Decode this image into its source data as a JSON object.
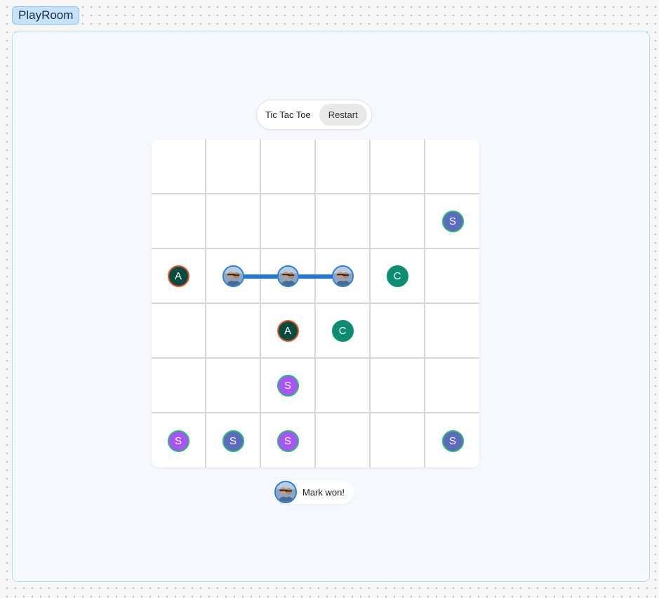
{
  "app": {
    "title": "PlayRoom"
  },
  "game": {
    "title": "Tic Tac Toe",
    "restart_label": "Restart"
  },
  "board": {
    "rows": 6,
    "cols": 6,
    "cells": [
      [
        null,
        null,
        null,
        null,
        null,
        null
      ],
      [
        null,
        null,
        null,
        null,
        null,
        {
          "type": "letter",
          "letter": "S",
          "bg": "#5c6bc0",
          "ring": "#2bb673"
        }
      ],
      [
        {
          "type": "letter",
          "letter": "A",
          "bg": "#0b4a3f",
          "ring": "#e0552a"
        },
        {
          "type": "photo"
        },
        {
          "type": "photo"
        },
        {
          "type": "photo"
        },
        {
          "type": "letter",
          "letter": "C",
          "bg": "#0e8c72",
          "ring": "#0e8c72"
        },
        null
      ],
      [
        null,
        null,
        {
          "type": "letter",
          "letter": "A",
          "bg": "#0b4a3f",
          "ring": "#e0552a"
        },
        {
          "type": "letter",
          "letter": "C",
          "bg": "#0e8c72",
          "ring": "#0e8c72"
        },
        null,
        null
      ],
      [
        null,
        null,
        {
          "type": "letter",
          "letter": "S",
          "bg": "#a855f7",
          "ring": "#2bb673"
        },
        null,
        null,
        null
      ],
      [
        {
          "type": "letter",
          "letter": "S",
          "bg": "#a855f7",
          "ring": "#2bb673"
        },
        {
          "type": "letter",
          "letter": "S",
          "bg": "#5c6bc0",
          "ring": "#2bb673"
        },
        {
          "type": "letter",
          "letter": "S",
          "bg": "#a855f7",
          "ring": "#2bb673"
        },
        null,
        null,
        {
          "type": "letter",
          "letter": "S",
          "bg": "#5c6bc0",
          "ring": "#2bb673"
        }
      ]
    ],
    "winning_line": {
      "row": 2,
      "from_col": 1,
      "to_col": 3,
      "color": "#1f78d1"
    }
  },
  "status": {
    "text": "Mark won!"
  },
  "colors": {
    "accent": "#2b7bd6",
    "frame_bg": "#f5f9fe",
    "frame_border": "#b9daf6",
    "tag_bg": "#c6e2fb"
  }
}
